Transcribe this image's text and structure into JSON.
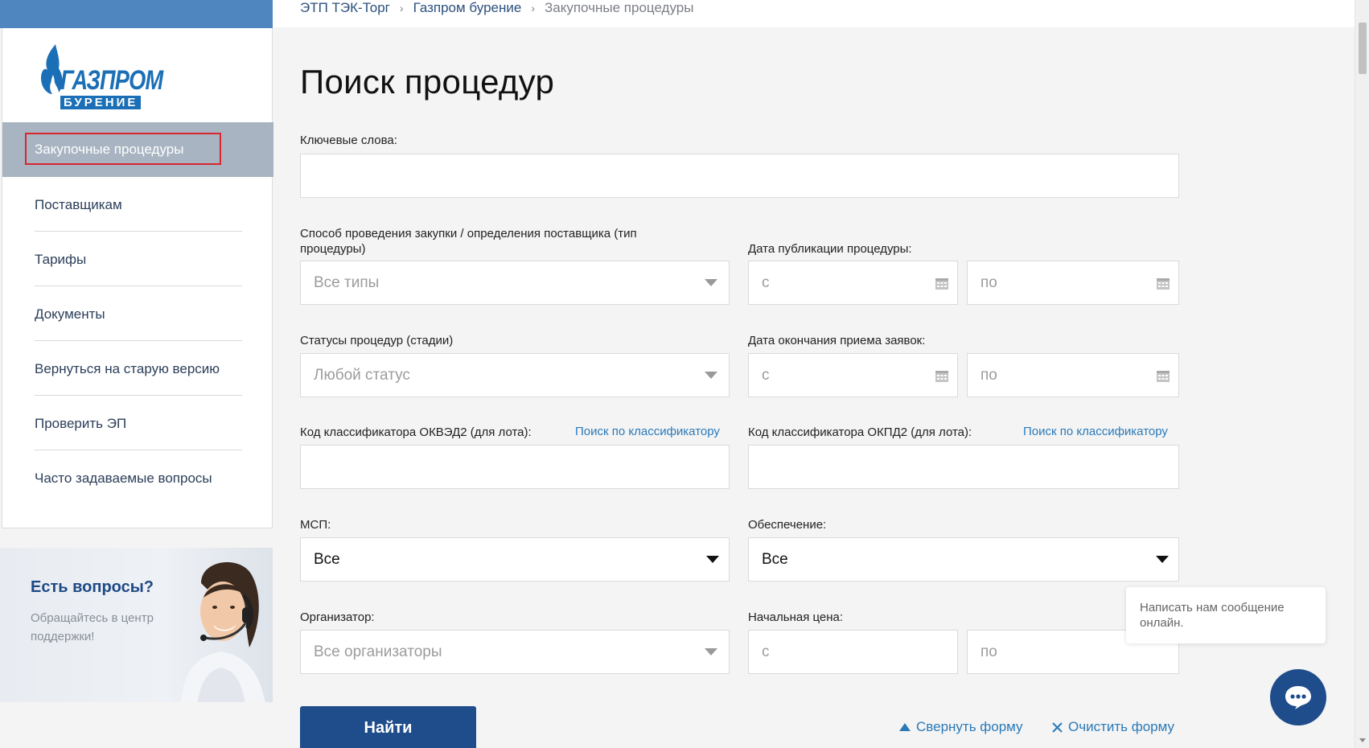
{
  "breadcrumb": [
    "ЭТП ТЭК-Торг",
    "Газпром бурение",
    "Закупочные процедуры"
  ],
  "logo": {
    "line1": "ГАЗПРОМ",
    "line2": "БУРЕНИЕ"
  },
  "sidebar": {
    "active": "Закупочные процедуры",
    "items": [
      "Поставщикам",
      "Тарифы",
      "Документы",
      "Вернуться на старую версию",
      "Проверить ЭП",
      "Часто задаваемые вопросы"
    ]
  },
  "support": {
    "title": "Есть вопросы?",
    "subtitle": "Обращайтесь в центр поддержки!"
  },
  "page_title": "Поиск процедур",
  "form": {
    "keywords_label": "Ключевые слова:",
    "keywords_value": "",
    "method_label": "Способ проведения закупки / определения поставщика (тип процедуры)",
    "method_value": "Все типы",
    "pub_date_label": "Дата публикации процедуры:",
    "pub_from": "с",
    "pub_to": "по",
    "status_label": "Статусы процедур (стадии)",
    "status_value": "Любой статус",
    "end_date_label": "Дата окончания приема заявок:",
    "end_from": "с",
    "end_to": "по",
    "okved_label": "Код классификатора ОКВЭД2 (для лота):",
    "okved_link": "Поиск по классификатору",
    "okpd_label": "Код классификатора ОКПД2 (для лота):",
    "okpd_link": "Поиск по классификатору",
    "msp_label": "МСП:",
    "msp_value": "Все",
    "security_label": "Обеспечение:",
    "security_value": "Все",
    "organizer_label": "Организатор:",
    "organizer_value": "Все организаторы",
    "price_label": "Начальная цена:",
    "price_from": "с",
    "price_to": "по",
    "find_button": "Найти",
    "collapse_link": "Свернуть форму",
    "clear_link": "Очистить форму"
  },
  "chat": {
    "message": "Написать нам сообщение онлайн."
  },
  "colors": {
    "primary": "#1f4c8a",
    "link": "#2b7ab8",
    "active_nav": "#a8b4c2",
    "highlight": "#d9262e"
  }
}
